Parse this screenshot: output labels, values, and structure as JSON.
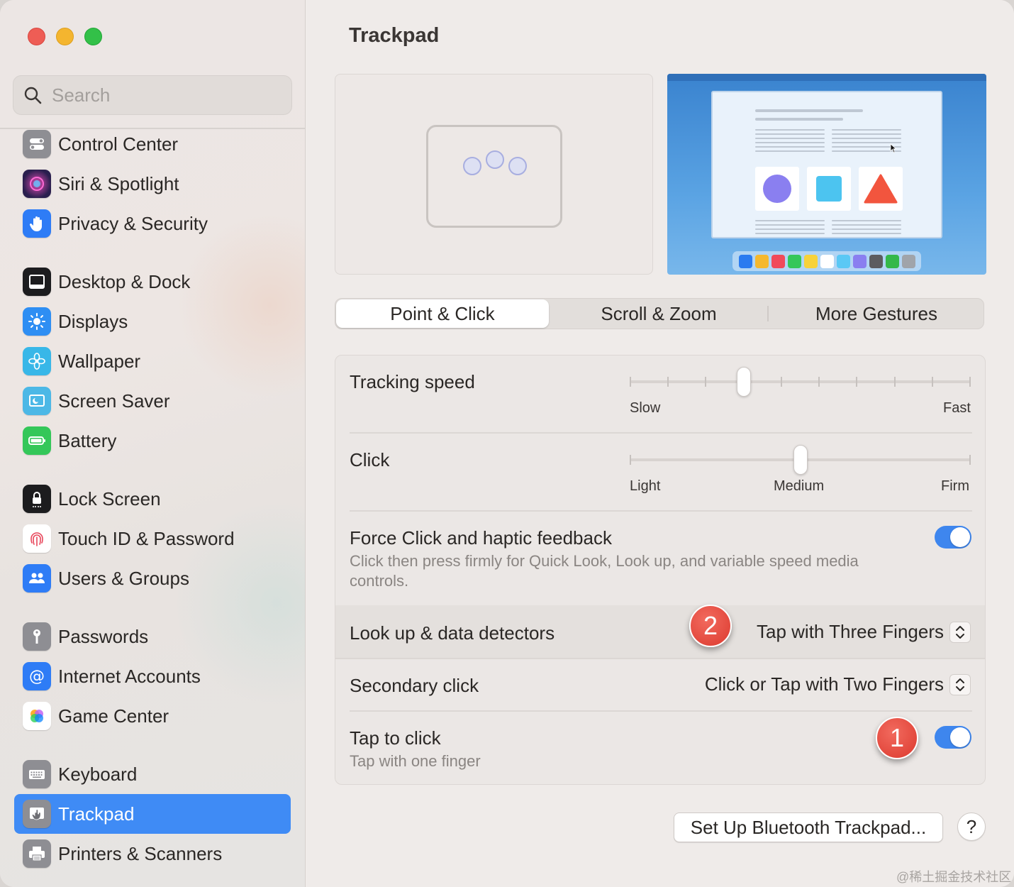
{
  "window": {
    "title": "Trackpad"
  },
  "search": {
    "placeholder": "Search"
  },
  "sidebar": {
    "items": [
      {
        "label": "Control Center",
        "icon": "control-center-icon",
        "color": "#8e8e93"
      },
      {
        "label": "Siri & Spotlight",
        "icon": "siri-icon",
        "color": "#b23fd0"
      },
      {
        "label": "Privacy & Security",
        "icon": "hand-icon",
        "color": "#2e7cf6"
      },
      {
        "label": "Desktop & Dock",
        "icon": "dock-icon",
        "color": "#1c1c1e"
      },
      {
        "label": "Displays",
        "icon": "sun-icon",
        "color": "#2e8ef3"
      },
      {
        "label": "Wallpaper",
        "icon": "flower-icon",
        "color": "#38b7e8"
      },
      {
        "label": "Screen Saver",
        "icon": "screen-saver-icon",
        "color": "#4cb8e6"
      },
      {
        "label": "Battery",
        "icon": "battery-icon",
        "color": "#34c759"
      },
      {
        "label": "Lock Screen",
        "icon": "lock-icon",
        "color": "#1c1c1e"
      },
      {
        "label": "Touch ID & Password",
        "icon": "fingerprint-icon",
        "color": "#ffffff"
      },
      {
        "label": "Users & Groups",
        "icon": "users-icon",
        "color": "#2e7cf6"
      },
      {
        "label": "Passwords",
        "icon": "key-icon",
        "color": "#8e8e93"
      },
      {
        "label": "Internet Accounts",
        "icon": "at-icon",
        "color": "#2e7cf6"
      },
      {
        "label": "Game Center",
        "icon": "game-center-icon",
        "color": "#ffffff"
      },
      {
        "label": "Keyboard",
        "icon": "keyboard-icon",
        "color": "#8e8e93"
      },
      {
        "label": "Trackpad",
        "icon": "trackpad-icon",
        "color": "#8e8e93"
      },
      {
        "label": "Printers & Scanners",
        "icon": "printer-icon",
        "color": "#8e8e93"
      }
    ],
    "active": "Trackpad"
  },
  "tabs": [
    {
      "label": "Point & Click",
      "selected": true
    },
    {
      "label": "Scroll & Zoom",
      "selected": false
    },
    {
      "label": "More Gestures",
      "selected": false
    }
  ],
  "settings": {
    "tracking_speed": {
      "label": "Tracking speed",
      "min_label": "Slow",
      "max_label": "Fast",
      "value_step": 3,
      "steps": 10
    },
    "click": {
      "label": "Click",
      "labels": [
        "Light",
        "Medium",
        "Firm"
      ],
      "value": "Medium"
    },
    "force_click": {
      "label": "Force Click and haptic feedback",
      "description": "Click then press firmly for Quick Look, Look up, and variable speed media controls.",
      "on": true
    },
    "look_up": {
      "label": "Look up & data detectors",
      "value": "Tap with Three Fingers"
    },
    "secondary_click": {
      "label": "Secondary click",
      "value": "Click or Tap with Two Fingers"
    },
    "tap_to_click": {
      "label": "Tap to click",
      "description": "Tap with one finger",
      "on": true
    }
  },
  "annotations": [
    {
      "number": "1",
      "target": "Tap to click"
    },
    {
      "number": "2",
      "target": "Look up & data detectors"
    }
  ],
  "footer": {
    "bluetooth_button": "Set Up Bluetooth Trackpad...",
    "help": "?"
  },
  "watermark": "@稀土掘金技术社区",
  "colors": {
    "accent": "#3e86ee",
    "badge": "#e3463b",
    "sidebar_selected": "#3f8bf5"
  }
}
